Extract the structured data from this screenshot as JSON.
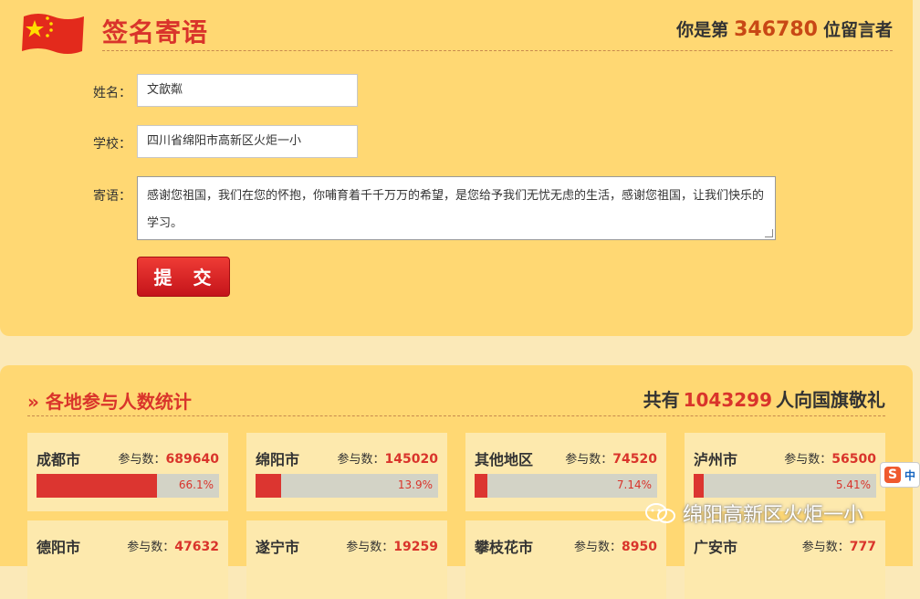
{
  "header": {
    "title": "签名寄语",
    "counter_prefix": "你是第",
    "counter_value": "346780",
    "counter_suffix": "位留言者"
  },
  "form": {
    "name_label": "姓名：",
    "name_value": "文歆粼",
    "school_label": "学校：",
    "school_value": "四川省绵阳市高新区火炬一小",
    "message_label": "寄语：",
    "message_value": "感谢您祖国，我们在您的怀抱，你哺育着千千万万的希望，是您给予我们无忧无虑的生活，感谢您祖国，让我们快乐的学习。",
    "submit_label": "提 交"
  },
  "stats": {
    "title": "» 各地参与人数统计",
    "total_prefix": "共有",
    "total_value": "1043299",
    "total_suffix": "人向国旗敬礼",
    "count_label": "参与数：",
    "cities": [
      {
        "name": "成都市",
        "count": "689640",
        "pct": "66.1%",
        "fraction": 0.661
      },
      {
        "name": "绵阳市",
        "count": "145020",
        "pct": "13.9%",
        "fraction": 0.139
      },
      {
        "name": "其他地区",
        "count": "74520",
        "pct": "7.14%",
        "fraction": 0.0714
      },
      {
        "name": "泸州市",
        "count": "56500",
        "pct": "5.41%",
        "fraction": 0.0541
      },
      {
        "name": "德阳市",
        "count": "47632"
      },
      {
        "name": "遂宁市",
        "count": "19259"
      },
      {
        "name": "攀枝花市",
        "count": "8950"
      },
      {
        "name": "广安市",
        "count": "777"
      }
    ]
  },
  "watermark": {
    "text": "绵阳高新区火炬一小"
  },
  "ime": {
    "logo": "S",
    "mode": "中"
  },
  "colors": {
    "accent_red": "#d9342b",
    "panel_yellow": "#ffd873",
    "bar_gray": "#d3d3c6"
  },
  "icons": {
    "flag": "china-flag-icon",
    "wechat": "wechat-icon"
  }
}
